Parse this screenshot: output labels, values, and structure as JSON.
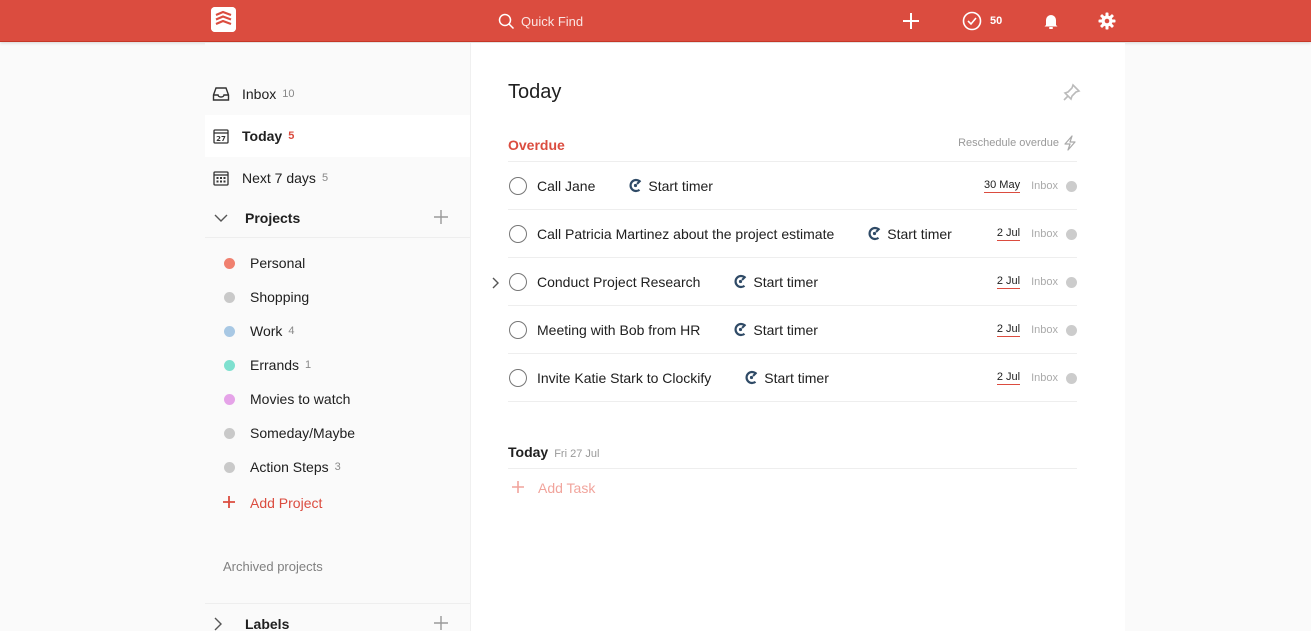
{
  "colors": {
    "brand": "#db4c3f",
    "overdue": "#db4c3f"
  },
  "topbar": {
    "search_placeholder": "Quick Find",
    "karma": "50"
  },
  "sidebar": {
    "nav": [
      {
        "label": "Inbox",
        "count": "10",
        "icon": "inbox-icon"
      },
      {
        "label": "Today",
        "count": "5",
        "icon": "calendar-today-icon"
      },
      {
        "label": "Next 7 days",
        "count": "5",
        "icon": "calendar-week-icon"
      }
    ],
    "projects_title": "Projects",
    "projects": [
      {
        "name": "Personal",
        "count": "",
        "color": "#f0806f"
      },
      {
        "name": "Shopping",
        "count": "",
        "color": "#c9c9c9"
      },
      {
        "name": "Work",
        "count": "4",
        "color": "#a8c8e4"
      },
      {
        "name": "Errands",
        "count": "1",
        "color": "#7ee0cf"
      },
      {
        "name": "Movies to watch",
        "count": "",
        "color": "#e5a3e8"
      },
      {
        "name": "Someday/Maybe",
        "count": "",
        "color": "#c9c9c9"
      },
      {
        "name": "Action Steps",
        "count": "3",
        "color": "#c9c9c9"
      }
    ],
    "add_project": "Add Project",
    "archived": "Archived projects",
    "labels_title": "Labels"
  },
  "main": {
    "title": "Today",
    "overdue_title": "Overdue",
    "reschedule": "Reschedule overdue",
    "timer_label": "Start timer",
    "tasks": [
      {
        "content": "Call Jane",
        "date": "30 May",
        "project": "Inbox"
      },
      {
        "content": "Call Patricia Martinez about the project estimate",
        "date": "2 Jul",
        "project": "Inbox"
      },
      {
        "content": "Conduct Project Research",
        "date": "2 Jul",
        "project": "Inbox"
      },
      {
        "content": "Meeting with Bob from HR",
        "date": "2 Jul",
        "project": "Inbox"
      },
      {
        "content": "Invite Katie Stark to Clockify",
        "date": "2 Jul",
        "project": "Inbox"
      }
    ],
    "today_title": "Today",
    "today_date": "Fri 27 Jul",
    "add_task": "Add Task"
  }
}
